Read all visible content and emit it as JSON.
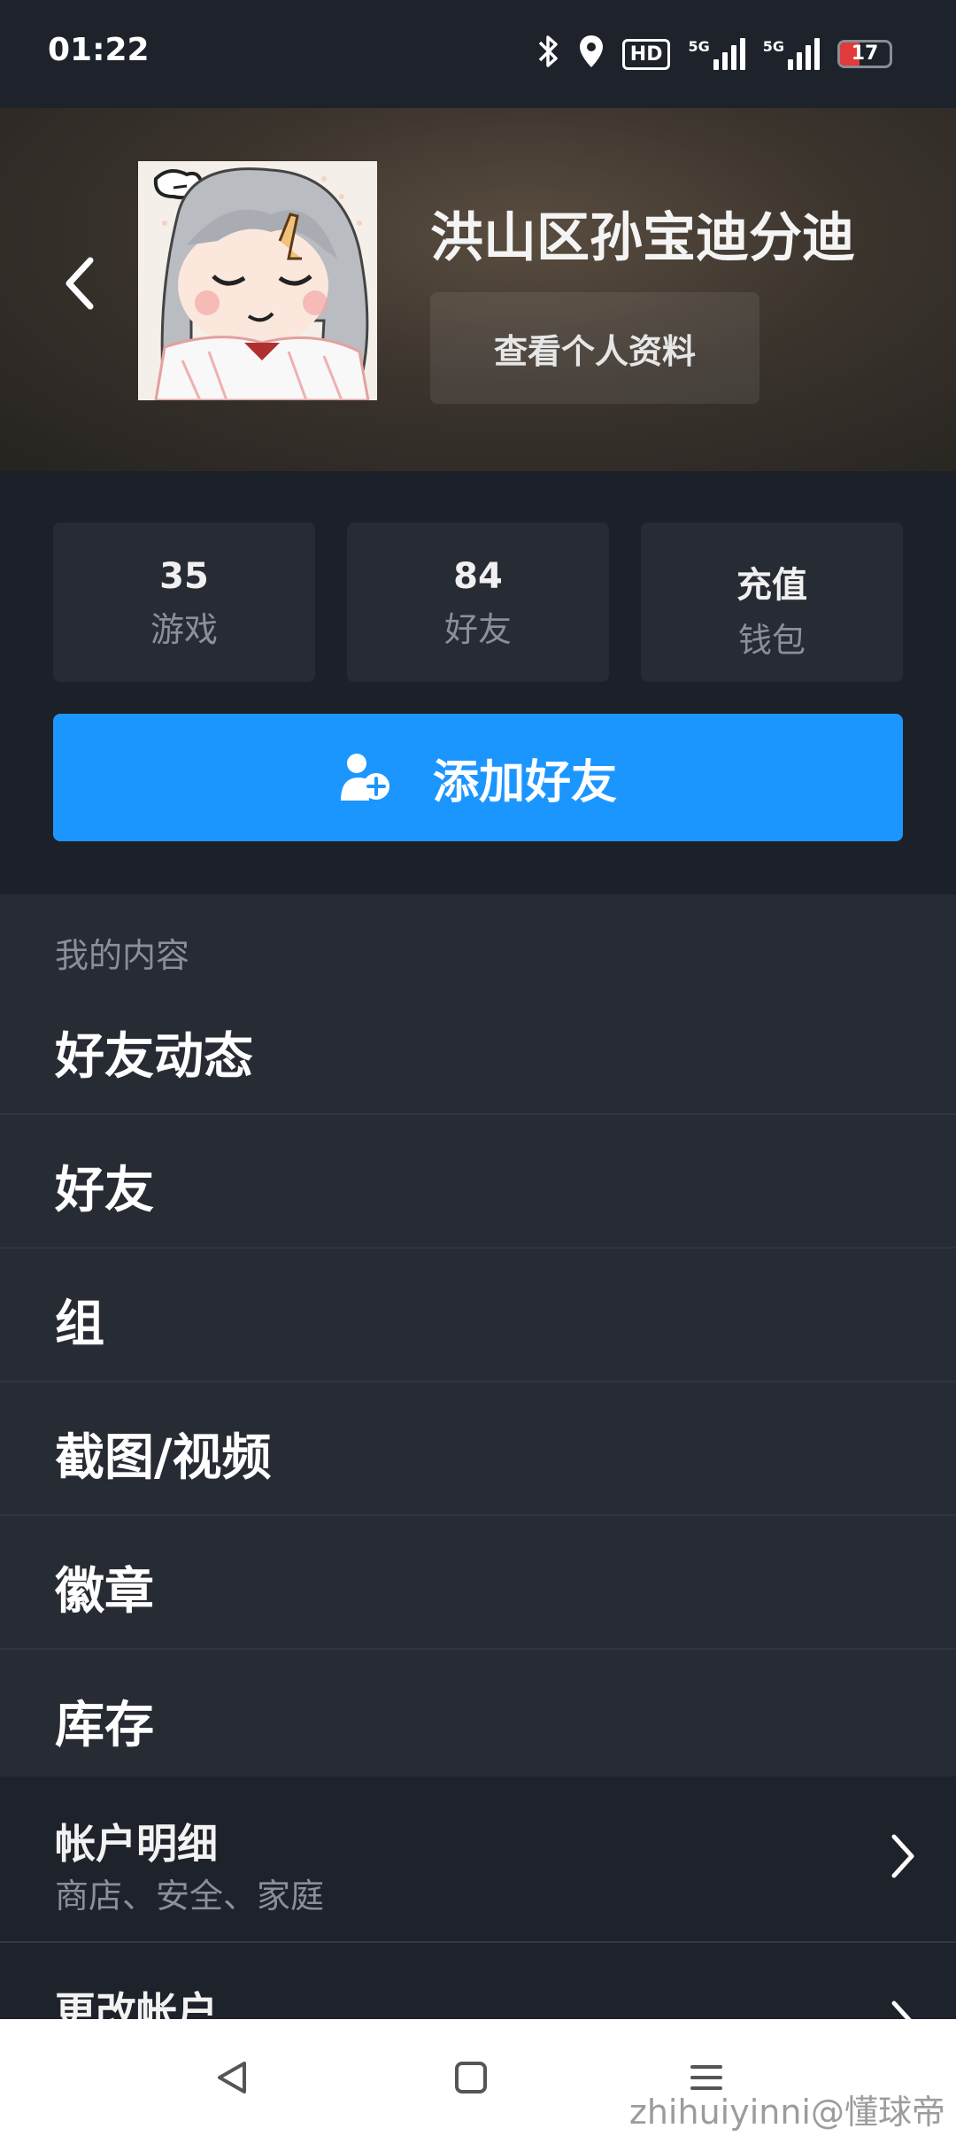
{
  "status_bar": {
    "time": "01:22",
    "hd_label": "HD",
    "sim1_label": "5G",
    "sim2_label": "5G",
    "battery_level": "17",
    "battery_color": "#e23b3b"
  },
  "profile": {
    "username": "洪山区孙宝迪分迪",
    "view_profile_label": "查看个人资料"
  },
  "stats": [
    {
      "value": "35",
      "label": "游戏"
    },
    {
      "value": "84",
      "label": "好友"
    },
    {
      "value": "充值",
      "label": "钱包"
    }
  ],
  "add_friend_label": "添加好友",
  "my_content": {
    "title": "我的内容",
    "items": [
      "好友动态",
      "好友",
      "组",
      "截图/视频",
      "徽章",
      "库存"
    ]
  },
  "account": {
    "details_title": "帐户明细",
    "details_subtitle": "商店、安全、家庭",
    "change_account": "更改帐户"
  },
  "watermark": "zhihuiyinni@懂球帝",
  "colors": {
    "accent": "#1c96ff",
    "background": "#1b1f27",
    "card": "#272b34"
  }
}
